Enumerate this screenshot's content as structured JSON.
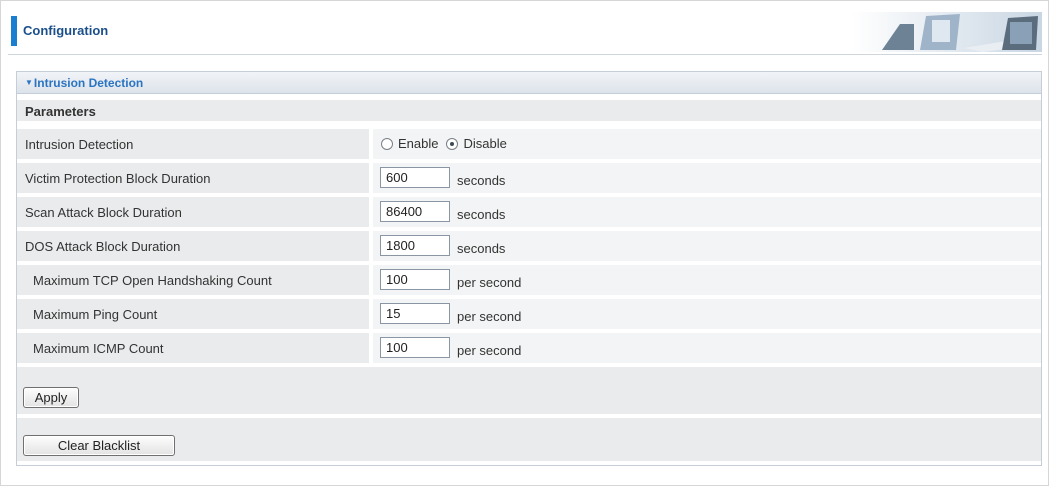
{
  "header": {
    "title": "Configuration"
  },
  "section": {
    "title": "Intrusion Detection",
    "params_label": "Parameters"
  },
  "intrusion": {
    "label": "Intrusion Detection",
    "enable_label": "Enable",
    "disable_label": "Disable",
    "selected": "Disable"
  },
  "rows": [
    {
      "label": "Victim Protection Block Duration",
      "value": "600",
      "unit": "seconds"
    },
    {
      "label": "Scan Attack Block Duration",
      "value": "86400",
      "unit": "seconds"
    },
    {
      "label": "DOS Attack Block Duration",
      "value": "1800",
      "unit": "seconds"
    },
    {
      "label": "Maximum TCP Open Handshaking Count",
      "value": "100",
      "unit": "per second"
    },
    {
      "label": "Maximum Ping Count",
      "value": "15",
      "unit": "per second"
    },
    {
      "label": "Maximum ICMP Count",
      "value": "100",
      "unit": "per second"
    }
  ],
  "buttons": {
    "apply": "Apply",
    "clear_blacklist": "Clear Blacklist"
  },
  "colors": {
    "accent_bar": "#1a7fd0",
    "section_title": "#2a74c2",
    "label_bg": "#e9ebed"
  },
  "icons": {
    "section_toggle": "triangle-down-icon"
  }
}
